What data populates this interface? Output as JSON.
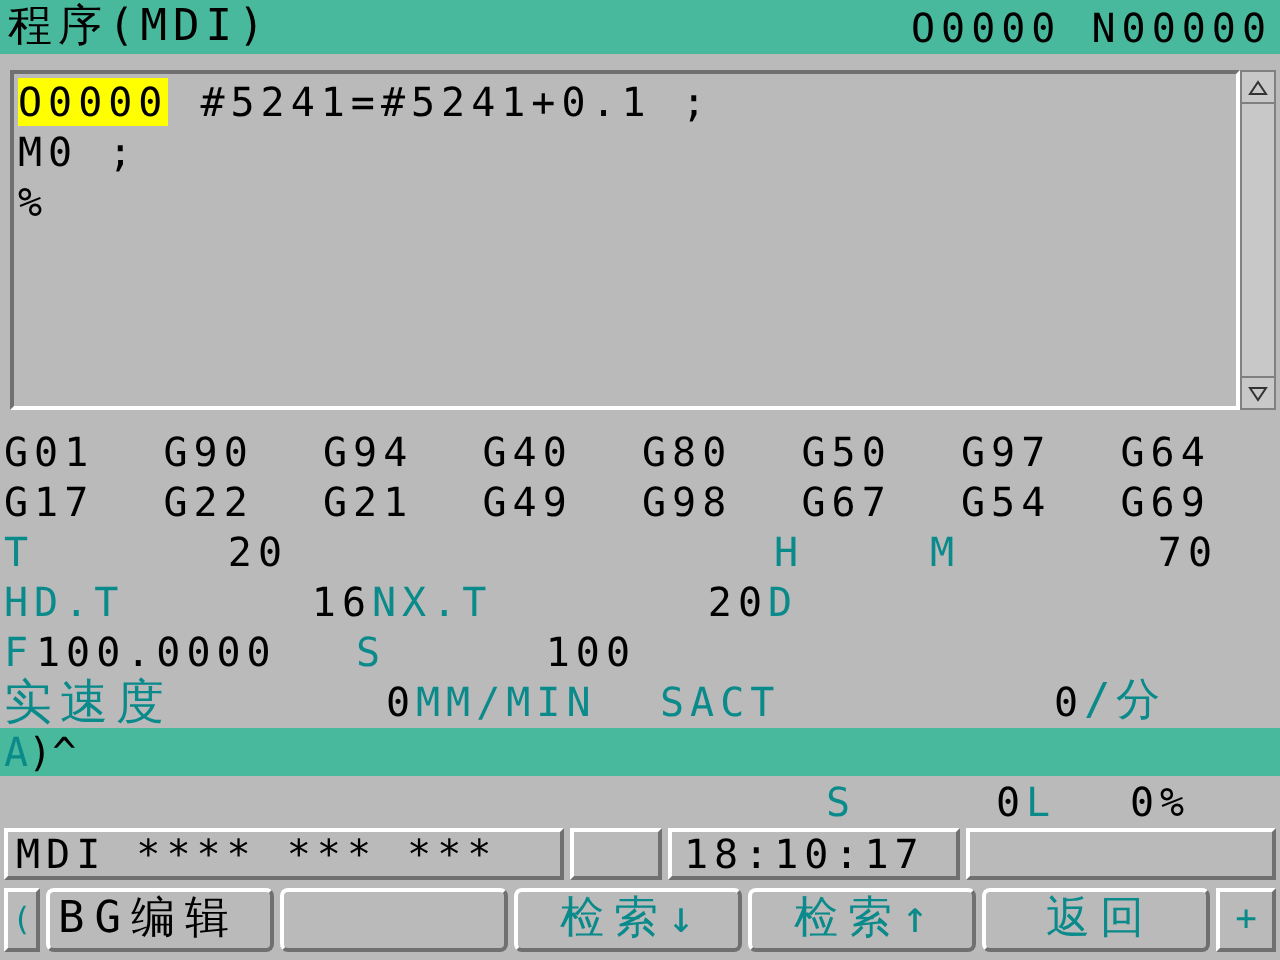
{
  "title_bar": {
    "title": "程序(MDI)",
    "program_number": "O0000 N00000"
  },
  "editor": {
    "lines": [
      {
        "tokens": [
          {
            "text": "O0000",
            "cursor": true
          },
          {
            "text": "#5241=#5241+0.1 ;",
            "cursor": false
          }
        ]
      },
      {
        "tokens": [
          {
            "text": "M0 ;",
            "cursor": false
          }
        ]
      },
      {
        "tokens": [
          {
            "text": "%",
            "cursor": false
          }
        ]
      }
    ]
  },
  "g_codes": [
    [
      "G01",
      "G90",
      "G94",
      "G40",
      "G80",
      "G50",
      "G97",
      "G64"
    ],
    [
      "G17",
      "G22",
      "G21",
      "G49",
      "G98",
      "G67",
      "G54",
      "G69"
    ]
  ],
  "modal_rows": [
    [
      {
        "kind": "label",
        "text": "T"
      },
      {
        "kind": "value",
        "text": "20"
      },
      {
        "kind": "label",
        "text": "H"
      },
      {
        "kind": "label",
        "text": "M"
      },
      {
        "kind": "value",
        "text": "70"
      }
    ],
    [
      {
        "kind": "label",
        "text": "HD.T"
      },
      {
        "kind": "value",
        "text": "16"
      },
      {
        "kind": "label",
        "text": "NX.T"
      },
      {
        "kind": "value",
        "text": "20"
      },
      {
        "kind": "label",
        "text": "D"
      }
    ],
    [
      {
        "kind": "label",
        "text": "F"
      },
      {
        "kind": "value",
        "text": "100.0000"
      },
      {
        "kind": "label",
        "text": "S"
      },
      {
        "kind": "value",
        "text": "100"
      }
    ]
  ],
  "actual_speed": [
    {
      "kind": "label",
      "text": "实速度"
    },
    {
      "kind": "value",
      "text": "0"
    },
    {
      "kind": "label",
      "text": "MM/MIN"
    },
    {
      "kind": "label",
      "text": "SACT"
    },
    {
      "kind": "value",
      "text": "0"
    },
    {
      "kind": "label",
      "text": "/分"
    }
  ],
  "input_line": {
    "prompt": "A",
    "value": ")^"
  },
  "spindle_row": [
    {
      "kind": "label",
      "text": "S"
    },
    {
      "kind": "value",
      "text": "0"
    },
    {
      "kind": "label",
      "text": "L"
    },
    {
      "kind": "value",
      "text": "0%"
    }
  ],
  "status_bar": {
    "mode": "MDI **** *** ***",
    "time": "18:10:17"
  },
  "soft_keys": {
    "prev": "(",
    "next": "+",
    "keys": [
      {
        "kind": "labeled",
        "label": "BG编辑",
        "color": "#000000"
      },
      {
        "kind": "blank"
      },
      {
        "kind": "labeled",
        "label": "检索↓",
        "color": "#0a8a8a"
      },
      {
        "kind": "labeled",
        "label": "检索↑",
        "color": "#0a8a8a"
      },
      {
        "kind": "labeled",
        "label": "返回",
        "color": "#0a8a8a"
      }
    ]
  }
}
